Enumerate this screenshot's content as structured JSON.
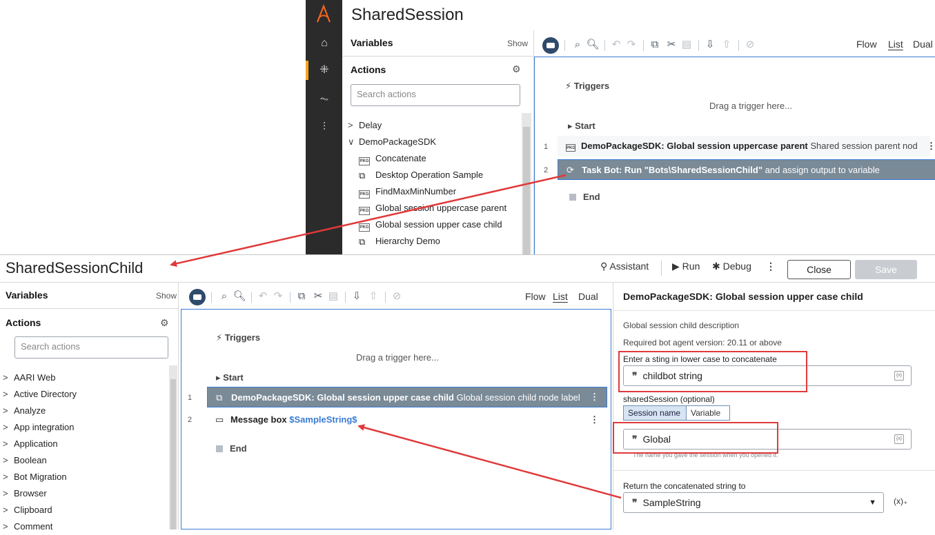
{
  "parent": {
    "title": "SharedSession",
    "variables_label": "Variables",
    "show_label": "Show",
    "actions_label": "Actions",
    "search_placeholder": "Search actions",
    "tree": [
      {
        "chev": ">",
        "label": "Delay",
        "icon": ""
      },
      {
        "chev": "∨",
        "label": "DemoPackageSDK",
        "icon": ""
      },
      {
        "chev": "",
        "label": "Concatenate",
        "icon": "pkg"
      },
      {
        "chev": "",
        "label": "Desktop Operation Sample",
        "icon": "bot"
      },
      {
        "chev": "",
        "label": "FindMaxMinNumber",
        "icon": "pkg"
      },
      {
        "chev": "",
        "label": "Global session uppercase parent",
        "icon": "pkg"
      },
      {
        "chev": "",
        "label": "Global session upper case child",
        "icon": "pkg"
      },
      {
        "chev": "",
        "label": "Hierarchy Demo",
        "icon": "bot"
      }
    ],
    "view_tabs": [
      "Flow",
      "List",
      "Dual"
    ],
    "selected_view": "List",
    "triggers_label": "Triggers",
    "drag_trigger": "Drag a trigger here...",
    "start_label": "Start",
    "end_label": "End",
    "steps": [
      {
        "num": "1",
        "title": "DemoPackageSDK: Global session uppercase parent",
        "desc": "Shared session parent nod"
      },
      {
        "num": "2",
        "title": "Task Bot: Run \"Bots\\SharedSessionChild\"",
        "desc": "and assign output to variable"
      }
    ]
  },
  "child": {
    "title": "SharedSessionChild",
    "header": {
      "assistant": "Assistant",
      "run": "Run",
      "debug": "Debug",
      "close": "Close",
      "save": "Save"
    },
    "variables_label": "Variables",
    "show_label": "Show",
    "actions_label": "Actions",
    "search_placeholder": "Search actions",
    "tree": [
      "AARI Web",
      "Active Directory",
      "Analyze",
      "App integration",
      "Application",
      "Boolean",
      "Bot Migration",
      "Browser",
      "Clipboard",
      "Comment"
    ],
    "view_tabs": [
      "Flow",
      "List",
      "Dual"
    ],
    "selected_view": "List",
    "triggers_label": "Triggers",
    "drag_trigger": "Drag a trigger here...",
    "start_label": "Start",
    "end_label": "End",
    "steps": [
      {
        "num": "1",
        "title": "DemoPackageSDK: Global session upper case child",
        "desc": "Global session child node label"
      },
      {
        "num": "2",
        "title": "Message box",
        "value": "$SampleString$"
      }
    ],
    "props": {
      "title": "DemoPackageSDK: Global session upper case child",
      "description": "Global session child description",
      "required_version": "Required bot agent version: 20.11 or above",
      "field1_label": "Enter a sting in lower case to concatenate",
      "field1_value": "childbot string",
      "shared_label": "sharedSession (optional)",
      "seg_session": "Session name",
      "seg_variable": "Variable",
      "field2_value": "Global",
      "field2_hint": "The name you gave the session when you opened it.",
      "return_label": "Return the concatenated string to",
      "return_value": "SampleString"
    }
  },
  "colors": {
    "accent_blue": "#3a7bd5",
    "annotation_red": "#e0393a",
    "selected_step": "#7a8a96",
    "rail_dark": "#2b2b2b",
    "rail_active": "#f5a623"
  }
}
